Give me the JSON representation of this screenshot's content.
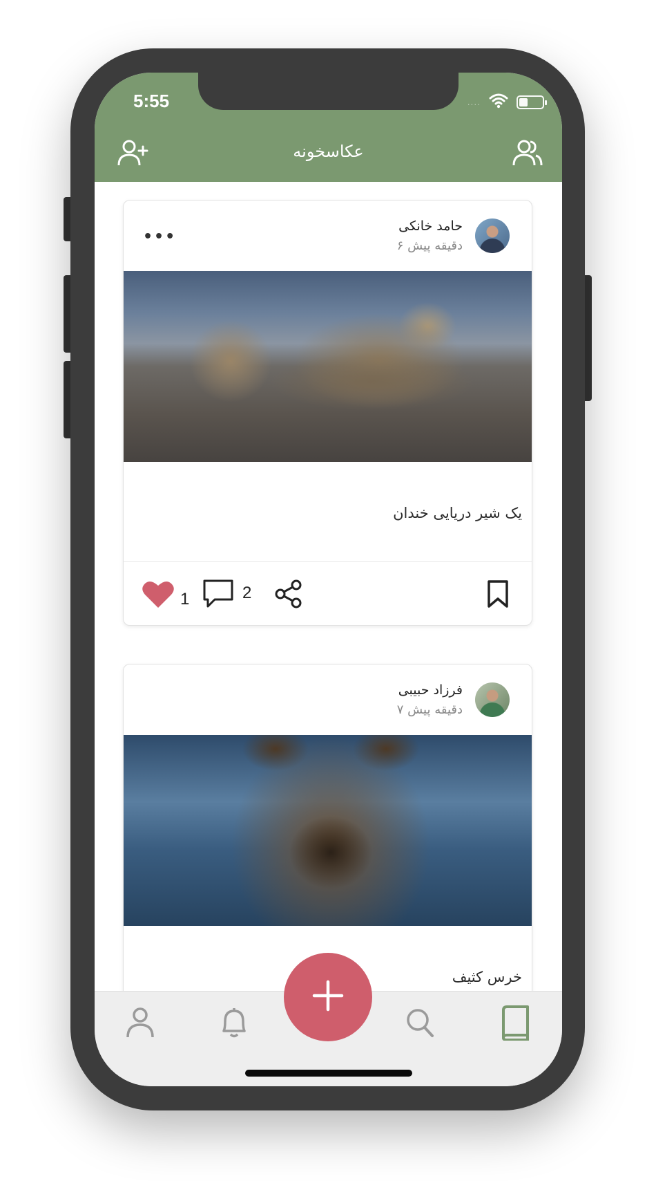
{
  "status_bar": {
    "time": "5:55",
    "signal_dots": "....",
    "icons": [
      "wifi-icon",
      "battery-icon"
    ]
  },
  "header": {
    "title": "عکاسخونه",
    "left_icon": "add-user-icon",
    "right_icon": "users-icon",
    "background": "#7b9970"
  },
  "posts": [
    {
      "author": "حامد خانکی",
      "time": "۶ دقیقه پیش",
      "photo": "seal",
      "caption": "یک شیر دریایی خندان",
      "likes": "1",
      "comments": "2",
      "liked": true,
      "more_label": "•••"
    },
    {
      "author": "فرزاد حبیبی",
      "time": "۷ دقیقه پیش",
      "photo": "bear",
      "caption": "خرس کثیف"
    }
  ],
  "tabbar": {
    "items": [
      "profile-icon",
      "bell-icon",
      "add-icon",
      "search-icon",
      "book-icon"
    ],
    "fab_symbol": "+",
    "active": "book-icon",
    "active_color": "#7b9970",
    "fab_color": "#cf5e6c"
  },
  "colors": {
    "accent": "#7b9970",
    "like": "#cf5e6c"
  }
}
